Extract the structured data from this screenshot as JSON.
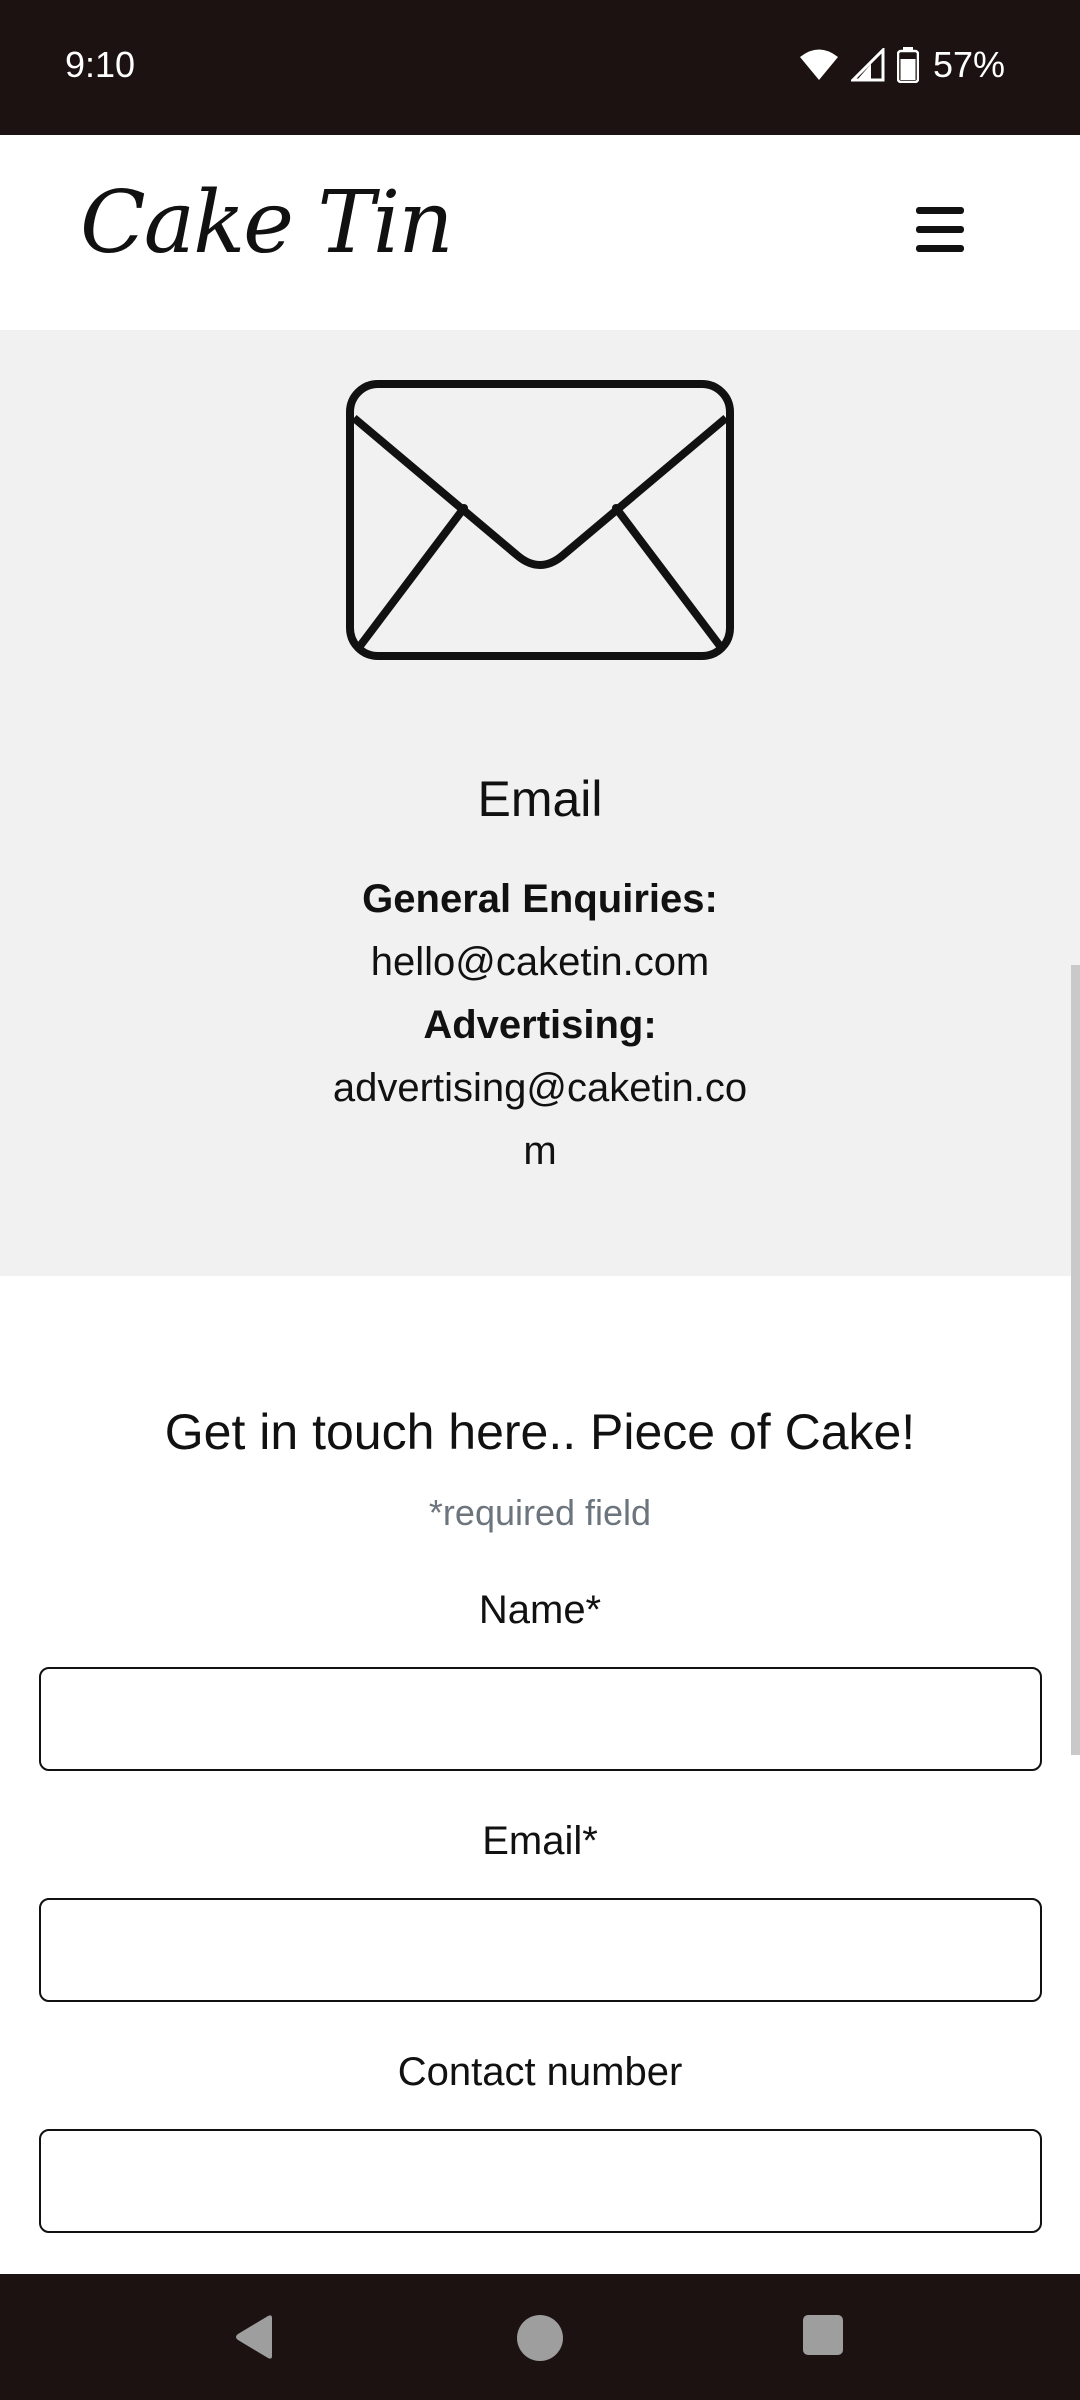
{
  "status_bar": {
    "time": "9:10",
    "battery": "57%",
    "icons": [
      "wifi-icon",
      "signal-icon",
      "battery-icon"
    ]
  },
  "header": {
    "logo": "Cake Tin",
    "menu_icon": "hamburger-menu-icon"
  },
  "email_section": {
    "icon": "envelope-icon",
    "title": "Email",
    "general_label": "General Enquiries:",
    "general_email": "hello@caketin.com",
    "advertising_label": "Advertising:",
    "advertising_email": "advertising@caketin.com"
  },
  "form": {
    "title": "Get in touch here.. Piece of Cake!",
    "required_note": "*required field",
    "name_label": "Name*",
    "name_value": "",
    "email_label": "Email*",
    "email_value": "",
    "phone_label": "Contact number",
    "phone_value": ""
  },
  "nav_bar": {
    "icons": [
      "back-icon",
      "home-icon",
      "recents-icon"
    ]
  },
  "colors": {
    "bars": "#1b1211",
    "email_section_bg": "#f1f1f1",
    "muted_text": "#6c757d"
  }
}
